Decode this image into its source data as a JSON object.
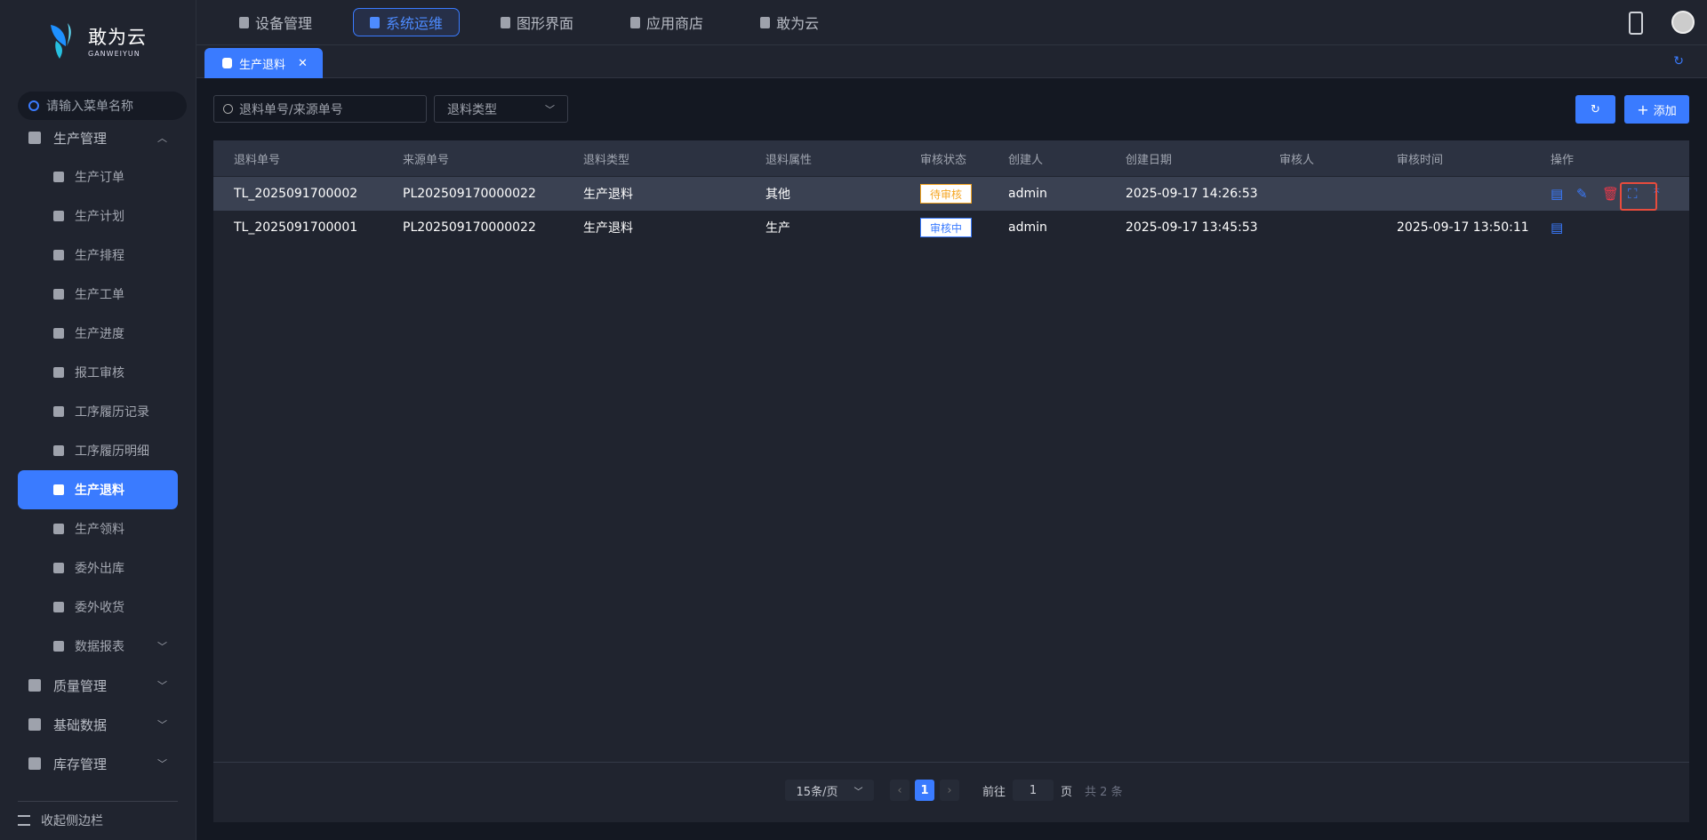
{
  "logo": {
    "cn": "敢为云",
    "en": "GANWEIYUN"
  },
  "sidebar": {
    "search_placeholder": "请输入菜单名称",
    "groups": [
      {
        "label": "生产管理"
      },
      {
        "label": "质量管理"
      },
      {
        "label": "基础数据"
      },
      {
        "label": "库存管理"
      }
    ],
    "items": [
      {
        "label": "生产订单"
      },
      {
        "label": "生产计划"
      },
      {
        "label": "生产排程"
      },
      {
        "label": "生产工单"
      },
      {
        "label": "生产进度"
      },
      {
        "label": "报工审核"
      },
      {
        "label": "工序履历记录"
      },
      {
        "label": "工序履历明细"
      },
      {
        "label": "生产退料"
      },
      {
        "label": "生产领料"
      },
      {
        "label": "委外出库"
      },
      {
        "label": "委外收货"
      },
      {
        "label": "数据报表"
      }
    ],
    "collapse_label": "收起侧边栏"
  },
  "topnav": {
    "items": [
      {
        "label": "设备管理"
      },
      {
        "label": "系统运维"
      },
      {
        "label": "图形界面"
      },
      {
        "label": "应用商店"
      },
      {
        "label": "敢为云"
      }
    ]
  },
  "tabs": [
    {
      "label": "生产退料"
    }
  ],
  "filters": {
    "search_placeholder": "退料单号/来源单号",
    "type_placeholder": "退料类型"
  },
  "toolbar": {
    "add_label": "添加"
  },
  "table": {
    "headers": [
      "退料单号",
      "来源单号",
      "退料类型",
      "退料属性",
      "审核状态",
      "创建人",
      "创建日期",
      "审核人",
      "审核时间",
      "操作"
    ],
    "rows": [
      {
        "id": "TL_2025091700002",
        "source": "PL202509170000022",
        "type": "生产退料",
        "attr": "其他",
        "status": "待审核",
        "creator": "admin",
        "created": "2025-09-17 14:26:53",
        "auditor": "",
        "audit_time": ""
      },
      {
        "id": "TL_2025091700001",
        "source": "PL202509170000022",
        "type": "生产退料",
        "attr": "生产",
        "status": "审核中",
        "creator": "admin",
        "created": "2025-09-17 13:45:53",
        "auditor": "",
        "audit_time": "2025-09-17 13:50:11"
      }
    ]
  },
  "pagination": {
    "page_size": "15条/页",
    "current": "1",
    "goto_label": "前往",
    "goto_value": "1",
    "page_unit": "页",
    "total": "共 2 条"
  },
  "colors": {
    "accent": "#3a7bff",
    "pending": "#f5a623",
    "danger": "#e8394a"
  }
}
